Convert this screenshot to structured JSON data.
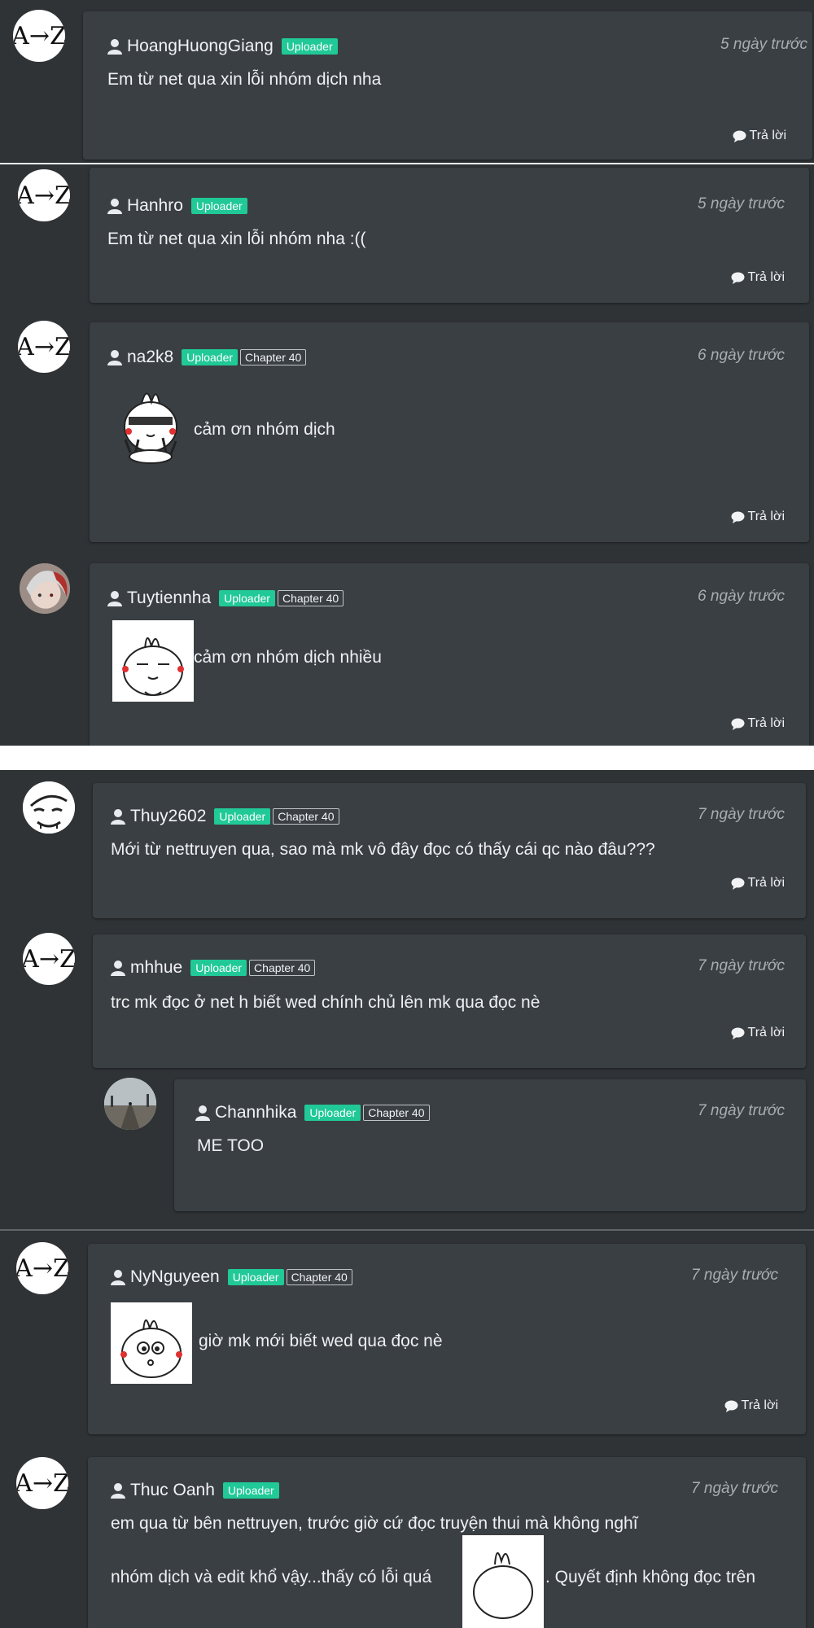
{
  "common": {
    "uploader_badge": "Uploader",
    "reply_label": "Trả lời"
  },
  "comments": [
    {
      "username": "HoangHuongGiang",
      "time": "5 ngày trước",
      "text": "Em từ net qua xin lỗi nhóm dịch nha",
      "avatar": "az-logo"
    },
    {
      "username": "Hanhro",
      "time": "5 ngày trước",
      "text": "Em từ net qua xin lỗi nhóm nha :((",
      "avatar": "az-logo"
    },
    {
      "username": "na2k8",
      "chapter": "Chapter 40",
      "time": "6 ngày trước",
      "text": "cảm ơn nhóm dịch",
      "avatar": "az-logo",
      "sticker": "rabbit-peace-sticker"
    },
    {
      "username": "Tuytiennha",
      "chapter": "Chapter 40",
      "time": "6 ngày trước",
      "text": "cảm ơn nhóm dịch nhiều",
      "avatar": "anime-character-avatar",
      "sticker": "rabbit-sleepy-sticker"
    },
    {
      "username": "Thuy2602",
      "chapter": "Chapter 40",
      "time": "7 ngày trước",
      "text": "Mới từ nettruyen qua, sao mà mk vô đây đọc có thấy cái qc nào đâu???",
      "avatar": "sketch-face-avatar"
    },
    {
      "username": "mhhue",
      "chapter": "Chapter 40",
      "time": "7 ngày trước",
      "text": "trc mk đọc ở net h biết wed chính chủ lên mk qua đọc nè",
      "avatar": "az-logo"
    },
    {
      "username": "Channhika",
      "chapter": "Chapter 40",
      "time": "7 ngày trước",
      "text": "ME TOO",
      "avatar": "landscape-avatar",
      "is_reply": true
    },
    {
      "username": "NyNguyeen",
      "chapter": "Chapter 40",
      "time": "7 ngày trước",
      "text": "giờ mk mới biết wed qua đọc nè",
      "avatar": "az-logo",
      "sticker": "rabbit-surprised-sticker"
    },
    {
      "username": "Thuc Oanh",
      "time": "7 ngày trước",
      "text_line1": "em qua từ bên nettruyen, trước giờ cứ đọc truyện thui mà không nghĩ",
      "text_line2a": "nhóm dịch và edit khổ vậy...thấy có lỗi quá",
      "text_line2b": ". Quyết định không đọc trên",
      "avatar": "az-logo",
      "sticker": "rabbit-sticker"
    }
  ],
  "colors": {
    "page_bg": "#2e3235",
    "card_bg": "#3a3f43",
    "uploader_badge": "#20c997",
    "time_text": "#a8adb2"
  }
}
